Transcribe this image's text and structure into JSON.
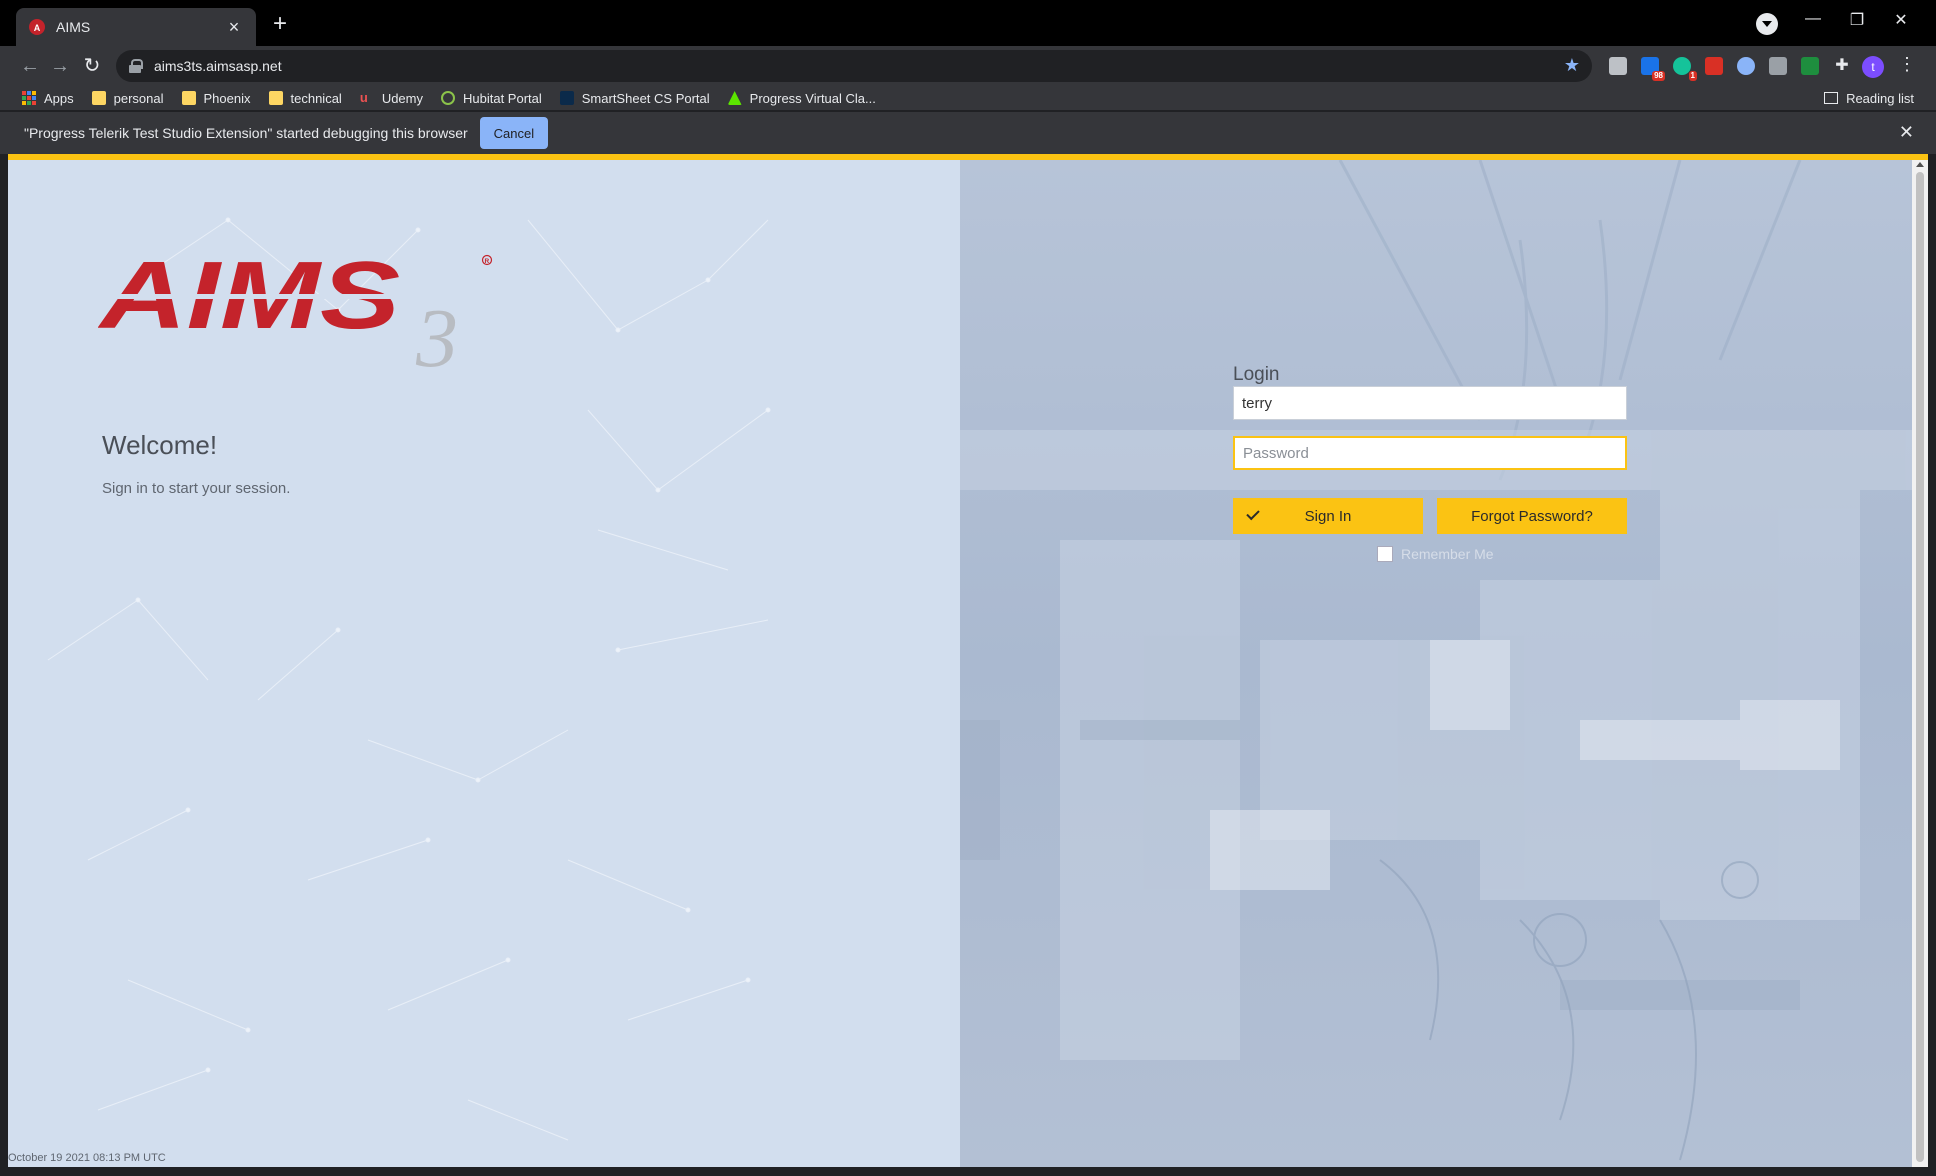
{
  "browser": {
    "tab": {
      "title": "AIMS"
    },
    "url": "aims3ts.aimsasp.net",
    "bookmarks": [
      {
        "label": "Apps",
        "icon": "apps-grid-icon"
      },
      {
        "label": "personal",
        "icon": "folder-icon"
      },
      {
        "label": "Phoenix",
        "icon": "folder-icon"
      },
      {
        "label": "technical",
        "icon": "folder-icon"
      },
      {
        "label": "Udemy",
        "icon": "udemy-icon"
      },
      {
        "label": "Hubitat Portal",
        "icon": "hubitat-icon"
      },
      {
        "label": "SmartSheet CS Portal",
        "icon": "smartsheet-icon"
      },
      {
        "label": "Progress Virtual Cla...",
        "icon": "progress-icon"
      }
    ],
    "reading_list": "Reading list",
    "extension_badges": {
      "calendar": "98",
      "grammarly": "1"
    },
    "profile_initial": "t",
    "infobar": {
      "message": "\"Progress Telerik Test Studio Extension\" started debugging this browser",
      "cancel_label": "Cancel"
    }
  },
  "page": {
    "logo_text": "AIMS",
    "logo_suffix": "3",
    "welcome": "Welcome!",
    "subtitle": "Sign in to start your session.",
    "login": {
      "heading": "Login",
      "username_value": "terry",
      "password_placeholder": "Password",
      "sign_in_label": "Sign In",
      "forgot_label": "Forgot Password?",
      "remember_label": "Remember Me"
    },
    "timestamp": "October 19 2021 08:13 PM UTC"
  },
  "colors": {
    "accent": "#fbc313",
    "brand_red": "#c4232b",
    "chrome_dark": "#35363a"
  }
}
